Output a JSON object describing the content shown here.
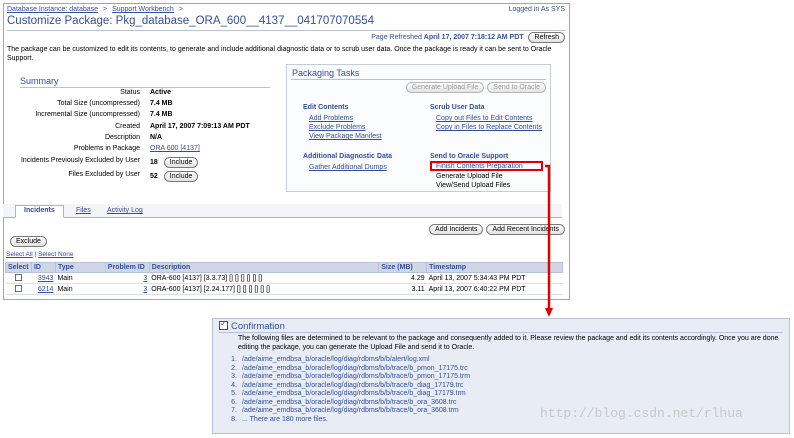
{
  "breadcrumbs": [
    "Database Instance: database",
    "Support Workbench"
  ],
  "breadcrumb_sep": ">",
  "logged_in": "Logged in As SYS",
  "page_title": "Customize Package: Pkg_database_ORA_600__4137__041707070554",
  "refresh": {
    "label": "Page Refreshed",
    "time": "April 17, 2007 7:18:12 AM PDT",
    "button": "Refresh"
  },
  "description": "The package can be customized to edit its contents, to generate and include additional diagnostic data or to scrub user data. Once the package is ready it can be sent to Oracle Support.",
  "summary": {
    "title": "Summary",
    "rows": [
      {
        "label": "Status",
        "value": "Active"
      },
      {
        "label": "Total Size (uncompressed)",
        "value": "7.4 MB"
      },
      {
        "label": "Incremental Size (uncompressed)",
        "value": "7.4 MB"
      },
      {
        "label": "Created",
        "value": "April 17, 2007 7:09:13 AM PDT"
      },
      {
        "label": "Description",
        "value": "N/A"
      },
      {
        "label": "Problems in Package",
        "value": "ORA 600 [4137]"
      },
      {
        "label": "Incidents Previously Excluded by User",
        "value": "18",
        "button": "Include"
      },
      {
        "label": "Files Excluded by User",
        "value": "52",
        "button": "Include"
      }
    ]
  },
  "packaging_tasks": {
    "title": "Packaging Tasks",
    "buttons": [
      "Generate Upload File",
      "Send to Oracle"
    ],
    "edit_contents": {
      "heading": "Edit Contents",
      "links": [
        "Add Problems",
        "Exclude Problems",
        "View Package Manifest"
      ]
    },
    "scrub": {
      "heading": "Scrub User Data",
      "links": [
        "Copy out Files to Edit Contents",
        "Copy in Files to Replace Contents"
      ]
    },
    "diagnostic": {
      "heading": "Additional Diagnostic Data",
      "links": [
        "Gather Additional Dumps"
      ]
    },
    "send": {
      "heading": "Send to Oracle Support",
      "link": "Finish Contents Preparation",
      "items": [
        "Generate Upload File",
        "View/Send Upload Files"
      ]
    }
  },
  "tabs": [
    "Incidents",
    "Files",
    "Activity Log"
  ],
  "table_buttons": [
    "Add Incidents",
    "Add Recent Incidents"
  ],
  "exclude_button": "Exclude",
  "select_all": "Select All",
  "select_none": "Select None",
  "table": {
    "headers": [
      "Select",
      "ID",
      "Type",
      "Problem ID",
      "Description",
      "Size (MB)",
      "Timestamp"
    ],
    "rows": [
      {
        "id": "3943",
        "type": "Main",
        "problem_id": "3",
        "description": "ORA-600 [4137] [3.3.73] [] [] [] [] [] []",
        "size": "4.29",
        "timestamp": "April 13, 2007 5:34:43 PM PDT"
      },
      {
        "id": "6214",
        "type": "Main",
        "problem_id": "3",
        "description": "ORA-600 [4137] [2.24.177] [] [] [] [] [] []",
        "size": "3.11",
        "timestamp": "April 13, 2007 6:40:22 PM PDT"
      }
    ]
  },
  "confirmation": {
    "title": "Confirmation",
    "message": "The following files are determined to be relevant to the package and consequently added to it. Please review the package and edit its contents accordingly. Once you are done editing the package, you can generate the Upload File and send it to Oracle.",
    "files": [
      "/ade/aime_emdbsa_b/oracle/log/diag/rdbms/b/b/alert/log.xml",
      "/ade/aime_emdbsa_b/oracle/log/diag/rdbms/b/b/trace/b_pmon_17175.trc",
      "/ade/aime_emdbsa_b/oracle/log/diag/rdbms/b/b/trace/b_pmon_17175.trm",
      "/ade/aime_emdbsa_b/oracle/log/diag/rdbms/b/b/trace/b_diag_17179.trc",
      "/ade/aime_emdbsa_b/oracle/log/diag/rdbms/b/b/trace/b_diag_17179.trm",
      "/ade/aime_emdbsa_b/oracle/log/diag/rdbms/b/b/trace/b_ora_3608.trc",
      "/ade/aime_emdbsa_b/oracle/log/diag/rdbms/b/b/trace/b_ora_3608.trm",
      "... There are 180 more files."
    ]
  },
  "watermark": "http://blog.csdn.net/rlhua",
  "colors": {
    "link": "#334f9a",
    "highlight": "#e00000",
    "header_bg": "#cfd7e6",
    "confirm_bg": "#e8ecf4"
  }
}
